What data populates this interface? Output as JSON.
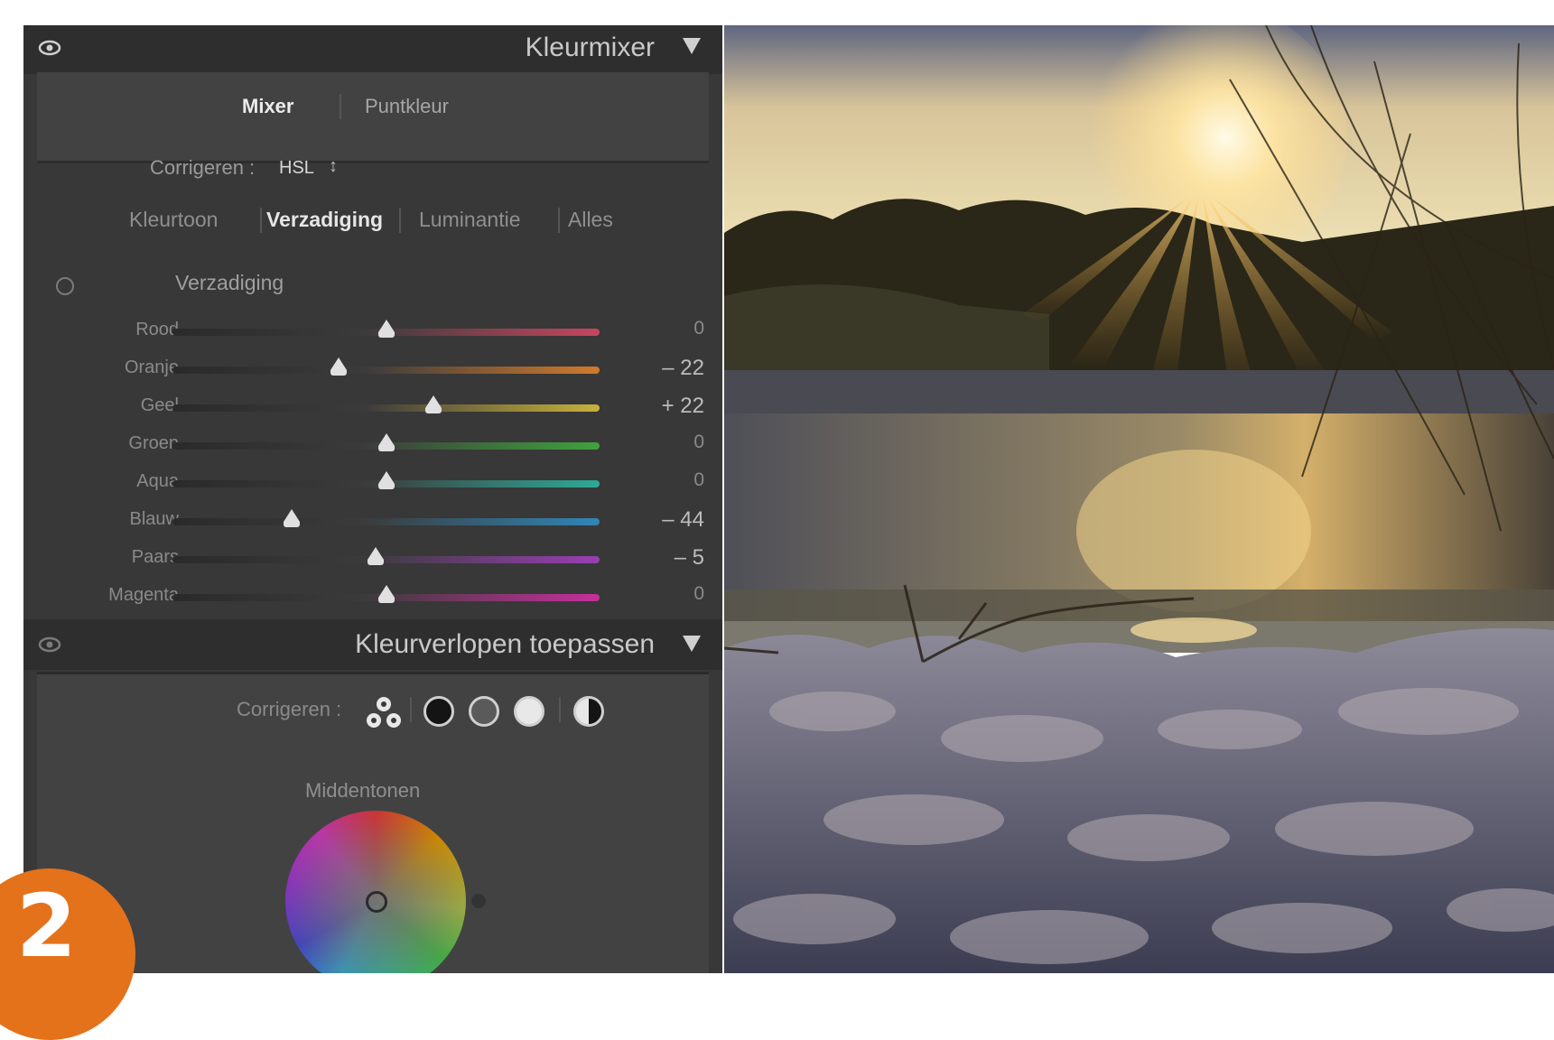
{
  "color_mixer": {
    "title": "Kleurmixer",
    "tabs": [
      {
        "label": "Mixer",
        "active": true
      },
      {
        "label": "Puntkleur",
        "active": false
      }
    ],
    "adjust_label": "Corrigeren :",
    "adjust_value": "HSL",
    "adjust_arrows": "↕",
    "subtabs": [
      {
        "label": "Kleurtoon",
        "active": false
      },
      {
        "label": "Verzadiging",
        "active": true
      },
      {
        "label": "Luminantie",
        "active": false
      },
      {
        "label": "Alles",
        "active": false
      }
    ],
    "section_title": "Verzadiging",
    "sliders": [
      {
        "label": "Rood",
        "value": 0,
        "display": "0",
        "color": "#c6465f"
      },
      {
        "label": "Oranje",
        "value": -22,
        "display": "– 22",
        "color": "#d17a2c"
      },
      {
        "label": "Geel",
        "value": 22,
        "display": "+ 22",
        "color": "#c8b23a"
      },
      {
        "label": "Groen",
        "value": 0,
        "display": "0",
        "color": "#3fa33c"
      },
      {
        "label": "Aqua",
        "value": 0,
        "display": "0",
        "color": "#2eaa98"
      },
      {
        "label": "Blauw",
        "value": -44,
        "display": "– 44",
        "color": "#2f86b8"
      },
      {
        "label": "Paars",
        "value": -5,
        "display": "– 5",
        "color": "#9a3fb5"
      },
      {
        "label": "Magenta",
        "value": 0,
        "display": "0",
        "color": "#c62f9b"
      }
    ]
  },
  "color_grading": {
    "title": "Kleurverlopen toepassen",
    "adjust_label": "Corrigeren :",
    "modes": [
      "3-way-icon",
      "shadows-icon",
      "midtones-icon",
      "highlights-icon",
      "global-icon"
    ],
    "selected_mode": "midtones-icon",
    "section_title": "Middentonen"
  },
  "step_badge": "2"
}
